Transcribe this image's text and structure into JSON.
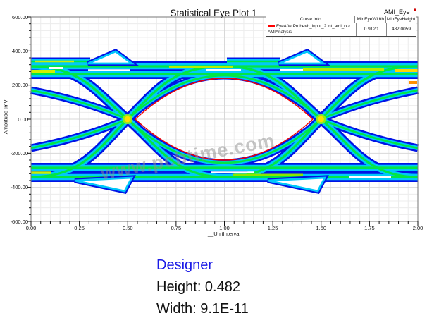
{
  "header": {
    "title": "Statistical Eye Plot 1",
    "corner_label": "AMI_Eye",
    "corner_marker": "▲"
  },
  "legend": {
    "headers": [
      "Curve Info",
      "MinEyeWidth",
      "MinEyeHeight"
    ],
    "row": {
      "curve_name": "EyeAfterProbe<b_input_2.int_ami_rx>",
      "dataset": "AMIAnalysis",
      "min_eye_width": "0.9120",
      "min_eye_height": "482.0059",
      "swatch_color": "#ff0000"
    }
  },
  "axes": {
    "y_label": "__Amplitude [mV]",
    "x_label": "__UnitInterval",
    "y_ticks": [
      "600.00",
      "400.00",
      "200.00",
      "0.00",
      "-200.00",
      "-400.00",
      "-600.00"
    ],
    "x_ticks": [
      "0.00",
      "0.25",
      "0.50",
      "0.75",
      "1.00",
      "1.25",
      "1.50",
      "1.75",
      "2.00"
    ]
  },
  "watermark": "www.pcbtime.com",
  "footer": {
    "designer": "Designer",
    "height": "Height: 0.482",
    "width": "Width: 9.1E-11",
    "designer_color": "#1a1ae6"
  },
  "chart_data": {
    "type": "heatmap",
    "subtype": "statistical-eye-diagram",
    "title": "Statistical Eye Plot 1",
    "xlabel": "__UnitInterval",
    "ylabel": "__Amplitude [mV]",
    "xlim": [
      0,
      2
    ],
    "ylim": [
      -600,
      600
    ],
    "x_tick_values": [
      0,
      0.25,
      0.5,
      0.75,
      1.0,
      1.25,
      1.5,
      1.75,
      2.0
    ],
    "y_tick_values": [
      600,
      400,
      200,
      0,
      -200,
      -400,
      -600
    ],
    "grid": true,
    "legend_position": "top-right",
    "eye_crossings_unit_interval": [
      0.5,
      1.5
    ],
    "crossing_amplitude_mv": 0,
    "top_rail_center_mv": 290,
    "bottom_rail_center_mv": -315,
    "inner_eye_contour": {
      "color": "#ff0000",
      "apex_amplitude_mv": 241,
      "crossing_points_ui": [
        0.544,
        1.456
      ]
    },
    "min_eye_width_ui": 0.912,
    "min_eye_height_mv": 482.0059,
    "density_color_scale_low_to_high": [
      "#0014e6",
      "#00c8fa",
      "#00e646",
      "#c6f000",
      "#ffe000",
      "#ff9000"
    ],
    "series": [
      {
        "name": "EyeAfterProbe<b_input_2.int_ami_rx>",
        "dataset": "AMIAnalysis",
        "min_eye_width": 0.912,
        "min_eye_height": 482.0059
      }
    ]
  }
}
